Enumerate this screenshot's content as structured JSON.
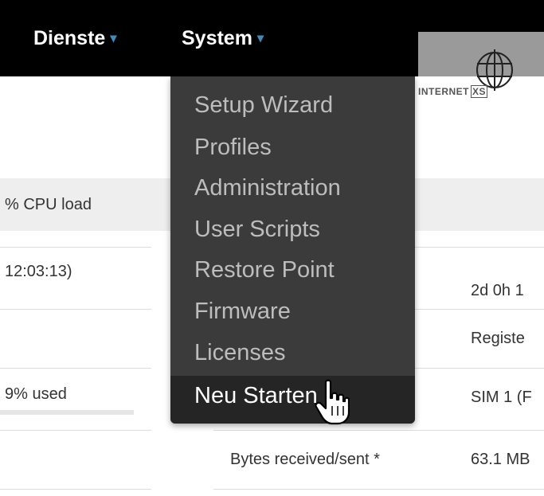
{
  "navbar": {
    "items": [
      {
        "label": "Dienste"
      },
      {
        "label": "System"
      }
    ],
    "caret": "▾"
  },
  "logo": {
    "text": "INTERNET",
    "badge": "XS"
  },
  "system_menu": {
    "items": [
      {
        "label": "Setup Wizard"
      },
      {
        "label": "Profiles"
      },
      {
        "label": "Administration"
      },
      {
        "label": "User Scripts"
      },
      {
        "label": "Restore Point"
      },
      {
        "label": "Firmware"
      },
      {
        "label": "Licenses"
      },
      {
        "label": "Neu Starten"
      }
    ],
    "active_item": "Neu Starten"
  },
  "left_column": {
    "cpu_load": "% CPU load",
    "time": "12:03:13)",
    "storage_used": "9% used"
  },
  "right_column": {
    "uptime": "2d 0h 1",
    "status": "Registe",
    "sim": "SIM 1 (F",
    "bytes_label": "Bytes received/sent *",
    "bytes_value": "63.1 MB"
  },
  "colors": {
    "navbar_bg": "#000000",
    "caret": "#3c8dbc",
    "dropdown_bg": "#3b3b3b"
  }
}
